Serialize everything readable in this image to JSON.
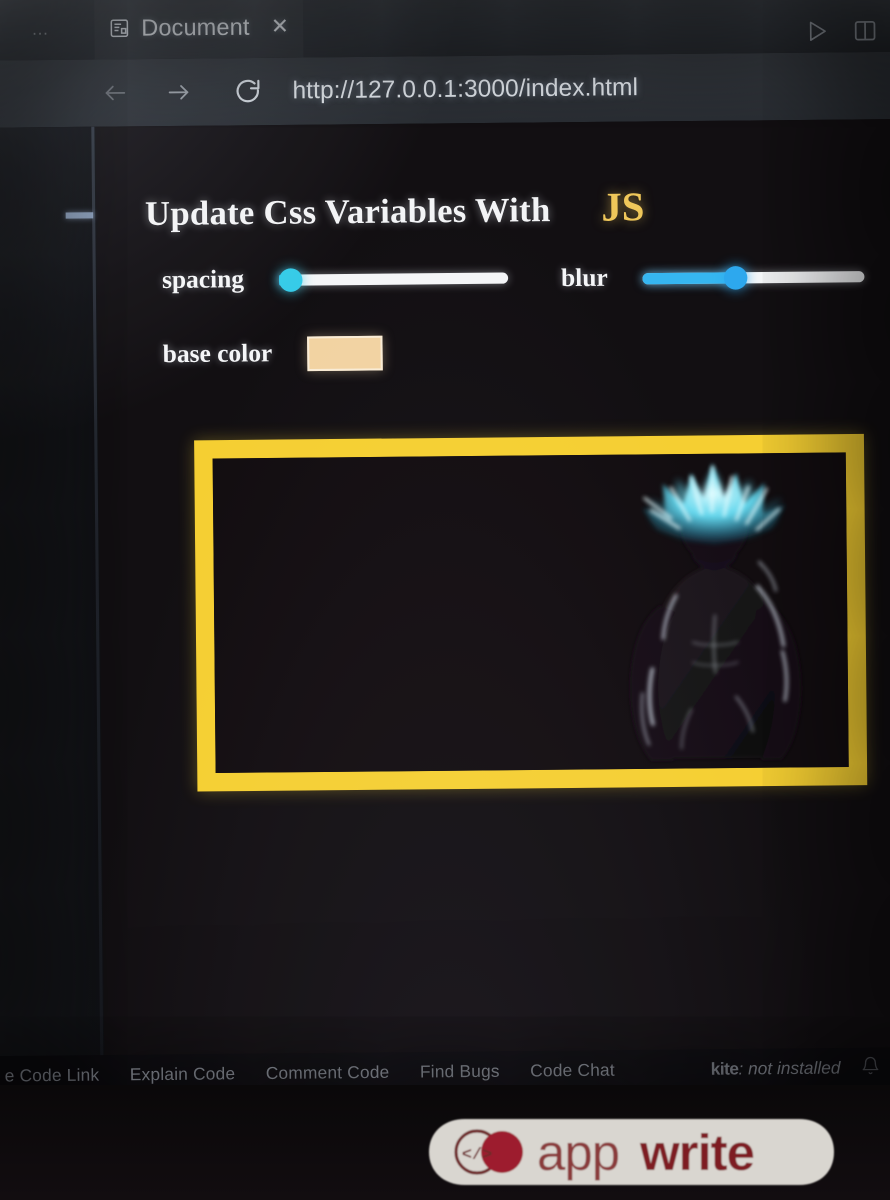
{
  "editor": {
    "overflow_menu": "…",
    "tab": {
      "icon": "document-file-icon",
      "title": "Document",
      "close": "✕"
    },
    "actions": [
      {
        "name": "run-preview-button",
        "icon": "play-triangle-icon"
      },
      {
        "name": "split-editor-button",
        "icon": "split-pane-icon"
      }
    ]
  },
  "browser": {
    "back": "←",
    "forward": "→",
    "reload": "⟳",
    "url": "http://127.0.0.1:3000/index.html"
  },
  "page": {
    "heading_main": "Update Css Variables With",
    "heading_accent": "JS",
    "controls": [
      {
        "label": "spacing",
        "type": "range",
        "value_pct": 2,
        "thumb_color": "#35cbe8",
        "track_color": "#f4f5f7"
      },
      {
        "label": "blur",
        "type": "range",
        "value_pct": 42,
        "thumb_color": "#2da8ee",
        "fill_color": "#36b6f0",
        "track_color": "#f4f5f7"
      },
      {
        "label": "base color",
        "type": "color",
        "value": "#f2d3a2"
      }
    ],
    "image": {
      "name": "framed-preview-image",
      "border_color": "#f5cf32",
      "border_width_px": 18,
      "background": "#120d10",
      "subject": "anime character with glowing blue spiky hair"
    }
  },
  "statusbar": {
    "items": [
      "e Code Link",
      "Explain Code",
      "Comment Code",
      "Find Bugs",
      "Code Chat"
    ],
    "kite_prefix": "kite",
    "kite_status": ": not installed",
    "bell_icon": "bell-icon"
  },
  "sticker": {
    "logo_mark": "code-brackets-circle-icon",
    "text_light": "app",
    "text_bold": "write",
    "color_light": "#8a3a3a",
    "color_bold": "#7e1f24",
    "outline": "#e6e3dd"
  }
}
